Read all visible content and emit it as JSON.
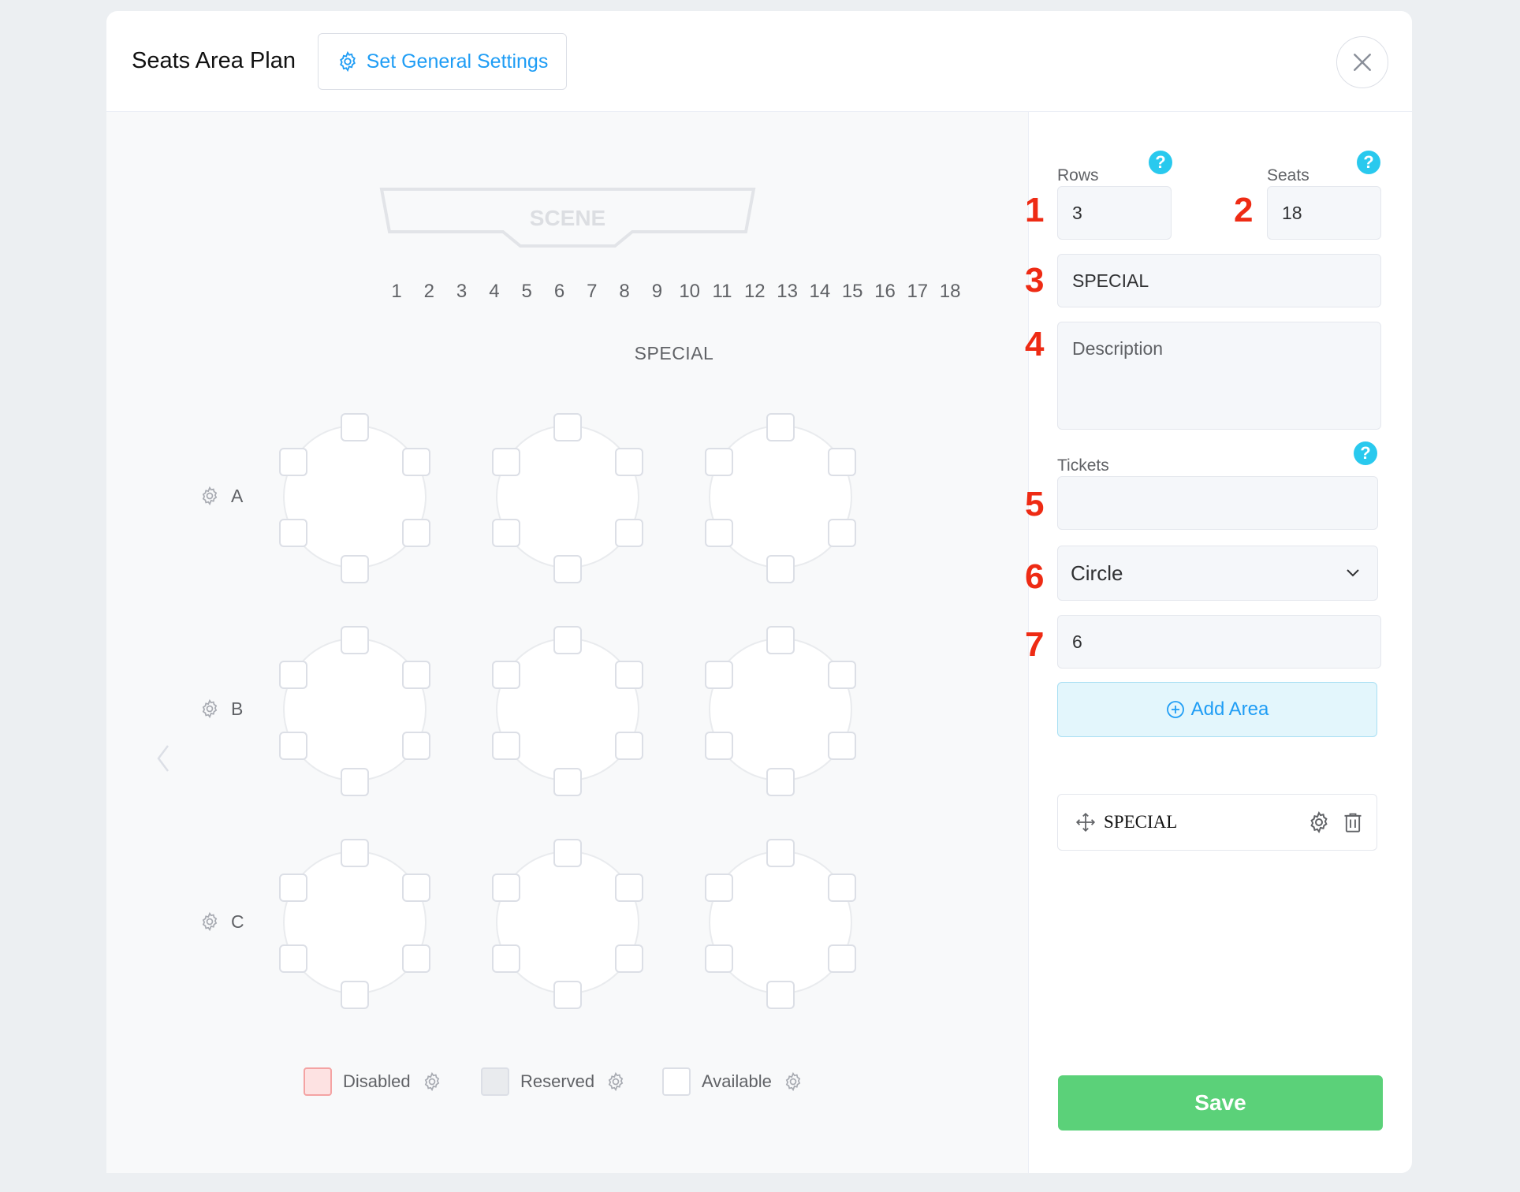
{
  "header": {
    "title": "Seats Area Plan",
    "general_settings_label": "Set General Settings"
  },
  "plan": {
    "stage_label": "SCENE",
    "column_numbers": [
      "1",
      "2",
      "3",
      "4",
      "5",
      "6",
      "7",
      "8",
      "9",
      "10",
      "11",
      "12",
      "13",
      "14",
      "15",
      "16",
      "17",
      "18"
    ],
    "area_name": "SPECIAL",
    "rows": [
      "A",
      "B",
      "C"
    ],
    "tables_per_row": 3,
    "seats_per_table": 6
  },
  "legend": [
    {
      "label": "Disabled",
      "color": "#fde2e2",
      "border": "#f4a3a3"
    },
    {
      "label": "Reserved",
      "color": "#e9ebee",
      "border": "#dcdfe6"
    },
    {
      "label": "Available",
      "color": "#ffffff",
      "border": "#dcdfe6"
    }
  ],
  "form": {
    "rows_label": "Rows",
    "rows_value": "3",
    "seats_label": "Seats",
    "seats_value": "18",
    "name_value": "SPECIAL",
    "description_placeholder": "Description",
    "tickets_label": "Tickets",
    "tickets_value": "",
    "shape_value": "Circle",
    "seats_per_table_value": "6",
    "help_glyph": "?",
    "add_area_label": "Add Area",
    "save_label": "Save"
  },
  "annotations": [
    "1",
    "2",
    "3",
    "4",
    "5",
    "6",
    "7"
  ],
  "area_list": [
    {
      "name": "SPECIAL"
    }
  ],
  "colors": {
    "accent": "#1f9df5",
    "help": "#29c9ee",
    "annotation": "#ee2b14",
    "save": "#5bd179"
  }
}
